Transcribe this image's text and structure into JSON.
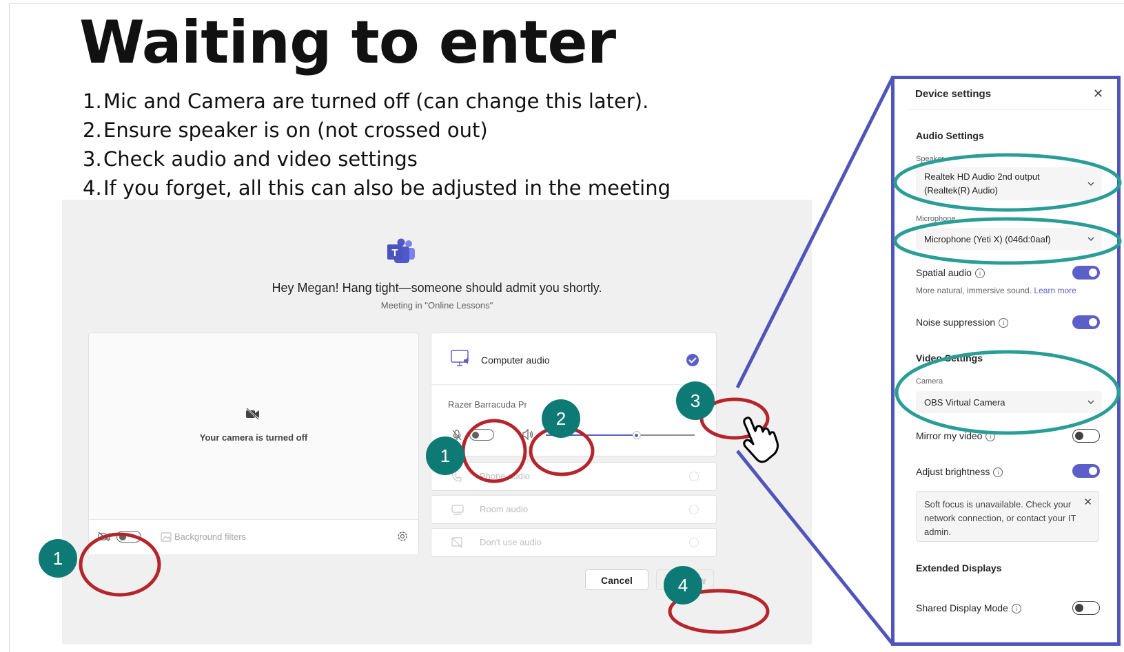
{
  "slide": {
    "title": "Waiting to enter",
    "steps": [
      {
        "num": "1.",
        "text": "Mic and Camera are turned off (can change this later)."
      },
      {
        "num": "2.",
        "text": "Ensure speaker is on (not crossed out)"
      },
      {
        "num": "3.",
        "text": "Check audio and video settings"
      },
      {
        "num": "4.",
        "text": "If you forget, all this can also be adjusted in the meeting"
      }
    ]
  },
  "lobby": {
    "greeting": "Hey Megan! Hang tight—someone should admit you shortly.",
    "meeting_subtitle": "Meeting in \"Online Lessons\"",
    "camera_off_text": "Your camera is turned off",
    "background_filters_label": "Background filters",
    "audio": {
      "computer_audio_label": "Computer audio",
      "device_name": "Razer Barracuda Pr",
      "volume_fraction": 0.61,
      "options": [
        {
          "label": "Phone audio",
          "icon": "phone-icon"
        },
        {
          "label": "Room audio",
          "icon": "room-icon"
        },
        {
          "label": "Don't use audio",
          "icon": "no-audio-icon"
        }
      ]
    },
    "cancel_label": "Cancel",
    "join_label": "Join now"
  },
  "device_settings": {
    "title": "Device settings",
    "close_symbol": "✕",
    "audio_heading": "Audio Settings",
    "speaker_label": "Speaker",
    "speaker_value_line1": "Realtek HD Audio 2nd output",
    "speaker_value_line2": "(Realtek(R) Audio)",
    "microphone_label": "Microphone",
    "microphone_value": "Microphone (Yeti X) (046d:0aaf)",
    "spatial_audio_label": "Spatial audio",
    "spatial_audio_on": true,
    "spatial_desc": "More natural, immersive sound.",
    "learn_more": "Learn more",
    "noise_label": "Noise suppression",
    "noise_on": true,
    "video_heading": "Video Settings",
    "camera_label": "Camera",
    "camera_value": "OBS Virtual Camera",
    "mirror_label": "Mirror my video",
    "mirror_on": false,
    "brightness_label": "Adjust brightness",
    "brightness_on": true,
    "soft_focus_note": "Soft focus is unavailable. Check your network connection, or contact your IT admin.",
    "extended_heading": "Extended Displays",
    "shared_display_label": "Shared Display Mode",
    "shared_display_on": false
  },
  "annotations": {
    "badges": [
      "1",
      "2",
      "3",
      "1",
      "4"
    ]
  },
  "colors": {
    "teams_purple": "#5b5fc7",
    "panel_border": "#5055b9",
    "badge_teal": "#0e7a76",
    "circle_teal": "#2a9d96",
    "circle_red": "#b5252c"
  }
}
